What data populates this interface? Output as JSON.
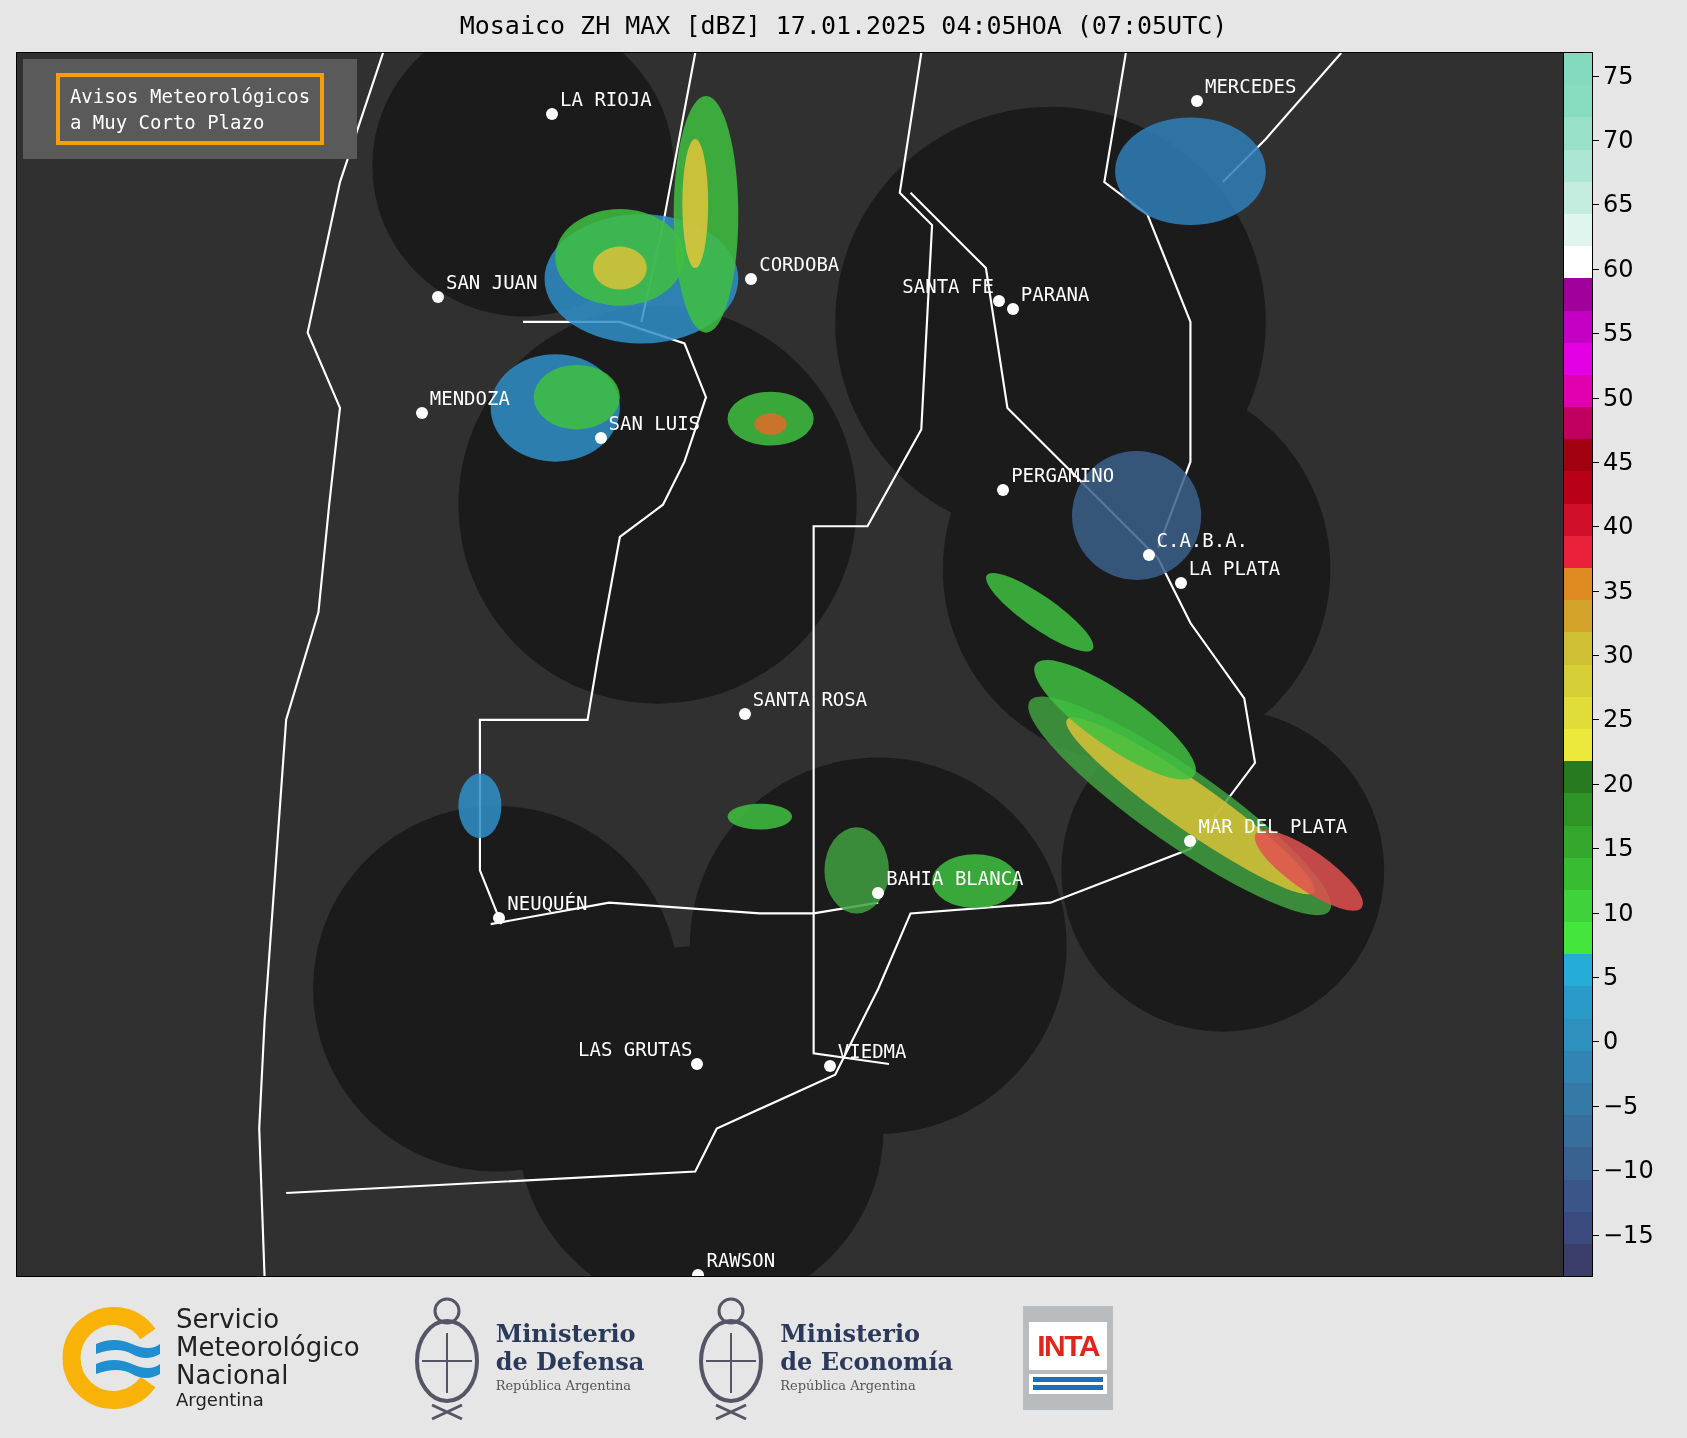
{
  "title": "Mosaico ZH MAX [dBZ] 17.01.2025 04:05HOA (07:05UTC)",
  "notice": "Avisos Meteorológicos\na Muy Corto Plazo",
  "cities": [
    {
      "name": "LA RIOJA"
    },
    {
      "name": "CORDOBA"
    },
    {
      "name": "SAN JUAN"
    },
    {
      "name": "SANTA FE"
    },
    {
      "name": "PARANA"
    },
    {
      "name": "MENDOZA"
    },
    {
      "name": "SAN LUIS"
    },
    {
      "name": "PERGAMINO"
    },
    {
      "name": "MERCEDES"
    },
    {
      "name": "C.A.B.A."
    },
    {
      "name": "LA PLATA"
    },
    {
      "name": "SANTA ROSA"
    },
    {
      "name": "MAR DEL PLATA"
    },
    {
      "name": "BAHIA BLANCA"
    },
    {
      "name": "NEUQUÉN"
    },
    {
      "name": "LAS GRUTAS"
    },
    {
      "name": "VIEDMA"
    },
    {
      "name": "RAWSON"
    }
  ],
  "colorbar": {
    "ticks": [
      "75",
      "70",
      "65",
      "60",
      "55",
      "50",
      "45",
      "40",
      "35",
      "30",
      "25",
      "20",
      "15",
      "10",
      "5",
      "0",
      "−5",
      "−10",
      "−15"
    ]
  },
  "logos": [
    {
      "kind": "smn",
      "lines": [
        "Servicio",
        "Meteorológico",
        "Nacional"
      ],
      "sub": "Argentina"
    },
    {
      "kind": "ministry",
      "lines": [
        "Ministerio",
        "de Defensa"
      ],
      "sub": "República Argentina"
    },
    {
      "kind": "ministry",
      "lines": [
        "Ministerio",
        "de Economía"
      ],
      "sub": "República Argentina"
    },
    {
      "kind": "inta",
      "lines": [
        "INTA"
      ]
    }
  ]
}
